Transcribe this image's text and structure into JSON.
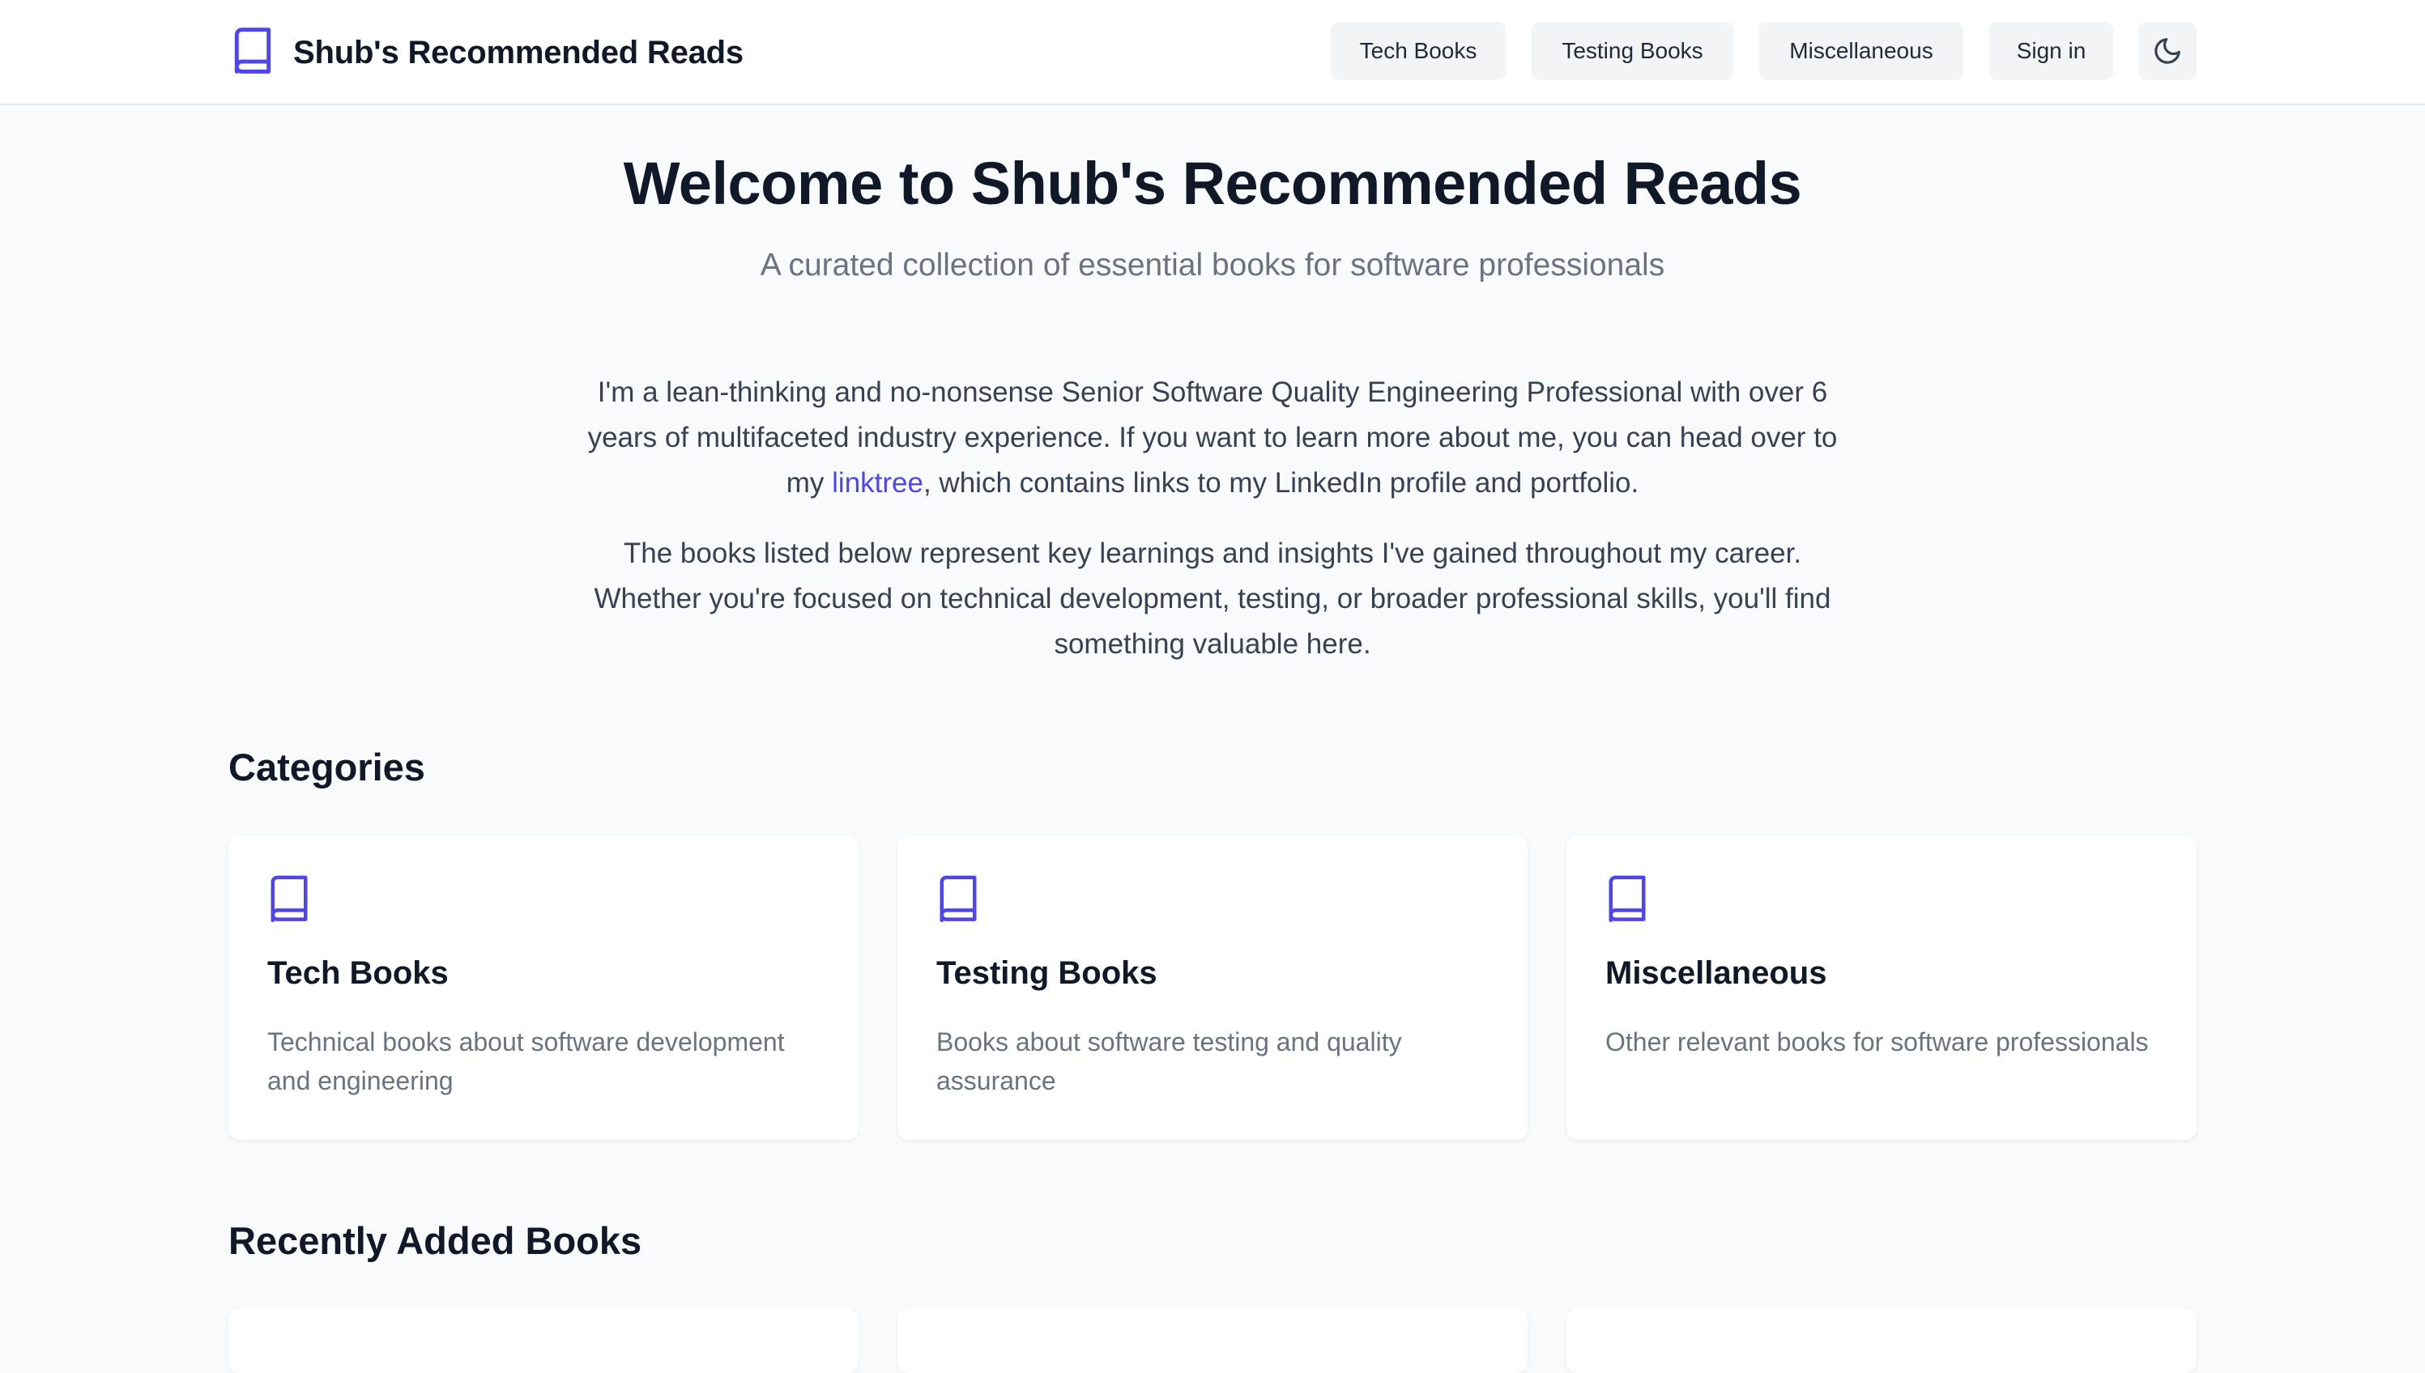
{
  "header": {
    "brand_title": "Shub's Recommended Reads",
    "brand_icon": "book-icon",
    "nav": {
      "tech": "Tech Books",
      "testing": "Testing Books",
      "misc": "Miscellaneous",
      "signin": "Sign in"
    },
    "theme_icon": "moon-icon"
  },
  "hero": {
    "title": "Welcome to Shub's Recommended Reads",
    "subtitle": "A curated collection of essential books for software professionals"
  },
  "intro": {
    "p1_before": "I'm a lean-thinking and no-nonsense Senior Software Quality Engineering Professional with over 6 years of multifaceted industry experience. If you want to learn more about me, you can head over to my ",
    "p1_link": "linktree",
    "p1_after": ", which contains links to my LinkedIn profile and portfolio.",
    "p2": "The books listed below represent key learnings and insights I've gained throughout my career. Whether you're focused on technical development, testing, or broader professional skills, you'll find something valuable here."
  },
  "categories": {
    "heading": "Categories",
    "items": [
      {
        "title": "Tech Books",
        "description": "Technical books about software development and engineering",
        "icon": "book-icon"
      },
      {
        "title": "Testing Books",
        "description": "Books about software testing and quality assurance",
        "icon": "book-icon"
      },
      {
        "title": "Miscellaneous",
        "description": "Other relevant books for software professionals",
        "icon": "book-icon"
      }
    ]
  },
  "recent": {
    "heading": "Recently Added Books"
  },
  "colors": {
    "accent": "#4f46e5",
    "background": "#f9fafb",
    "card": "#ffffff",
    "heading": "#111827",
    "muted": "#6b7280",
    "button_bg": "#f3f4f6"
  }
}
